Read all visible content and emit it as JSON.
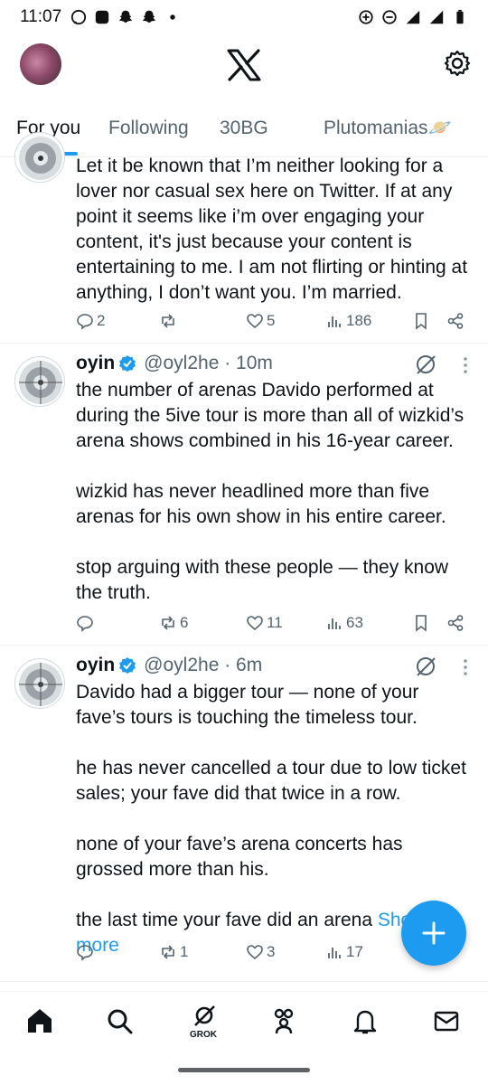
{
  "status_bar": {
    "time": "11:07"
  },
  "tabs": [
    {
      "label": "For you",
      "active": true
    },
    {
      "label": "Following",
      "active": false
    },
    {
      "label": "30BG",
      "active": false
    },
    {
      "label": "Plutomanias🪐",
      "active": false
    }
  ],
  "tweets": [
    {
      "text": "Let it be known that I’m neither looking for a lover nor casual sex here on Twitter. If at any point it seems like i’m over engaging your content, it's just because your content is entertaining to me. I am not flirting or hinting at anything, I don’t want you. I’m married.",
      "replies": "2",
      "reposts": "",
      "likes": "5",
      "views": "186"
    },
    {
      "name": "oyin",
      "handle": "@oyl2he · 10m",
      "paragraphs": [
        "the number of arenas Davido performed at during the 5ive tour is more than all of wizkid’s arena shows combined in his 16-year career.",
        "wizkid has never headlined more than five arenas for his own show in his entire career.",
        "stop arguing with these people — they know the truth."
      ],
      "replies": "",
      "reposts": "6",
      "likes": "11",
      "views": "63"
    },
    {
      "name": "oyin",
      "handle": "@oyl2he · 6m",
      "paragraphs": [
        "Davido had a bigger tour — none of your fave’s tours is touching the timeless tour.",
        "he has never cancelled a tour due to low ticket sales; your fave did that twice in a row.",
        "none of your fave’s arena concerts has grossed more than his."
      ],
      "last_line": "the last time your fave did an arena",
      "show_more": "Show more",
      "replies": "",
      "reposts": "1",
      "likes": "3",
      "views": "17"
    }
  ],
  "bottom_nav": {
    "grok_label": "GROK"
  },
  "colors": {
    "accent": "#1d9bf0",
    "text": "#0f1419",
    "muted": "#536471"
  }
}
